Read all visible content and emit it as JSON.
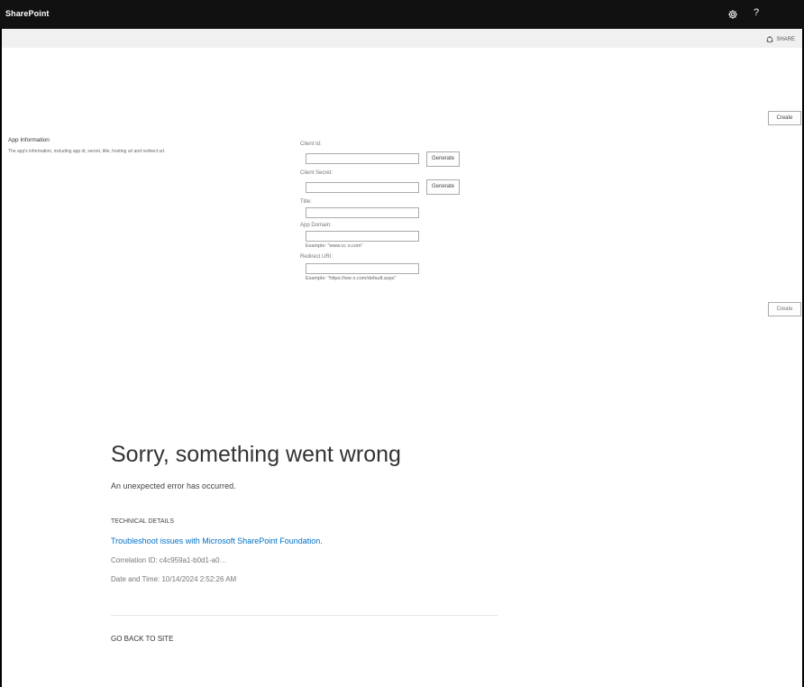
{
  "suite_bar": {
    "brand": "SharePoint",
    "help_label": "?"
  },
  "ribbon": {
    "share_label": "SHARE"
  },
  "buttons": {
    "create_top": "Create",
    "create_bottom": "Create"
  },
  "app_info": {
    "title": "App Information",
    "description": "The app's information, including app id, secret, title, hosting url and redirect url."
  },
  "form": {
    "client_id_label": "Client Id:",
    "client_id_value": "",
    "client_secret_label": "Client Secret:",
    "client_secret_value": "",
    "generate_label": "Generate",
    "title_label": "Title:",
    "title_value": "",
    "app_domain_label": "App Domain:",
    "app_domain_value": "",
    "app_domain_example": "Example: \"www.cc      o.com\"",
    "redirect_uri_label": "Redirect URI:",
    "redirect_uri_value": "",
    "redirect_uri_example": "Example: \"https://ww             o.com/default.aspx\""
  },
  "error": {
    "title": "Sorry, something went wrong",
    "message": "An unexpected error has occurred.",
    "technical_details": "TECHNICAL DETAILS",
    "troubleshoot_link": "Troubleshoot issues with Microsoft SharePoint Foundation.",
    "correlation": "Correlation ID: c4c959a1-b0d1-a0…",
    "datetime": "Date and Time: 10/14/2024 2:52:26 AM",
    "go_back": "GO BACK TO SITE"
  },
  "icons": {
    "settings": "gear-icon",
    "share": "share-icon"
  }
}
